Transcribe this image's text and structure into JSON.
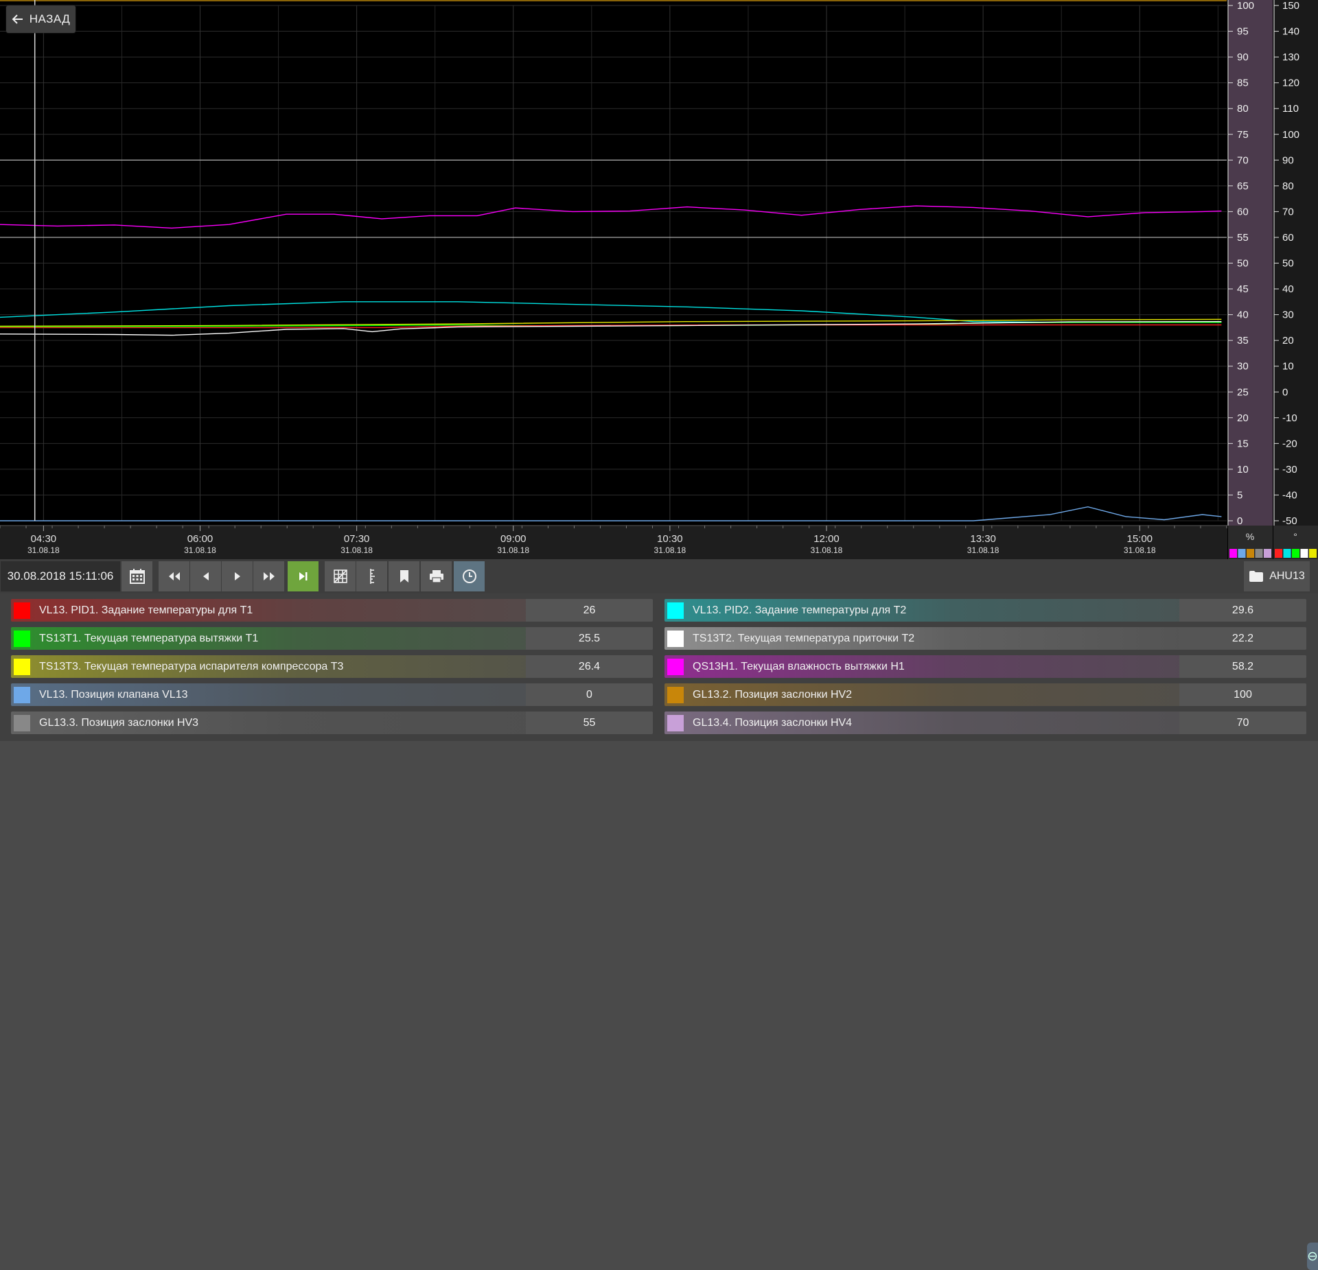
{
  "back_button": {
    "label": "НАЗАД",
    "icon": "arrow-left-icon"
  },
  "chart_data": {
    "type": "line",
    "x_ticks": [
      {
        "time": "04:30",
        "date": "31.08.18"
      },
      {
        "time": "06:00",
        "date": "31.08.18"
      },
      {
        "time": "07:30",
        "date": "31.08.18"
      },
      {
        "time": "09:00",
        "date": "31.08.18"
      },
      {
        "time": "10:30",
        "date": "31.08.18"
      },
      {
        "time": "12:00",
        "date": "31.08.18"
      },
      {
        "time": "13:30",
        "date": "31.08.18"
      },
      {
        "time": "15:00",
        "date": "31.08.18"
      }
    ],
    "xlim": [
      "04:05",
      "15:50"
    ],
    "y_axis_percent": {
      "unit": "%",
      "min": 0,
      "max": 100,
      "step": 5,
      "highlight_color": "#4b3a4c"
    },
    "y_axis_degrees": {
      "unit": "°",
      "min": -50,
      "max": 150,
      "step": 10
    },
    "grid": true,
    "cursor_time": "04:25",
    "reference_lines_percent": [
      70,
      55
    ],
    "series": [
      {
        "color": "#ff00ff",
        "axis": "percent",
        "points": [
          [
            0,
            57.5
          ],
          [
            30,
            57.2
          ],
          [
            60,
            57.4
          ],
          [
            90,
            56.8
          ],
          [
            120,
            57.5
          ],
          [
            150,
            59.5
          ],
          [
            175,
            59.5
          ],
          [
            200,
            58.6
          ],
          [
            225,
            59.2
          ],
          [
            250,
            59.2
          ],
          [
            270,
            60.7
          ],
          [
            300,
            60.0
          ],
          [
            330,
            60.1
          ],
          [
            360,
            60.9
          ],
          [
            390,
            60.3
          ],
          [
            420,
            59.3
          ],
          [
            450,
            60.4
          ],
          [
            480,
            61.1
          ],
          [
            510,
            60.8
          ],
          [
            540,
            60.1
          ],
          [
            570,
            59.0
          ],
          [
            600,
            59.8
          ],
          [
            630,
            60.0
          ],
          [
            640,
            60.1
          ]
        ]
      },
      {
        "color": "#00e5e5",
        "axis": "degrees",
        "points": [
          [
            0,
            29
          ],
          [
            60,
            31
          ],
          [
            120,
            33.5
          ],
          [
            180,
            35
          ],
          [
            240,
            35
          ],
          [
            300,
            34
          ],
          [
            360,
            33
          ],
          [
            420,
            31.5
          ],
          [
            480,
            29
          ],
          [
            510,
            27.3
          ],
          [
            560,
            27
          ],
          [
            640,
            27.2
          ]
        ]
      },
      {
        "color": "#e8e800",
        "axis": "degrees",
        "points": [
          [
            0,
            25.5
          ],
          [
            120,
            25.8
          ],
          [
            240,
            26.4
          ],
          [
            360,
            27.3
          ],
          [
            480,
            27.6
          ],
          [
            560,
            28
          ],
          [
            640,
            28.2
          ]
        ]
      },
      {
        "color": "#00ff00",
        "axis": "degrees",
        "points": [
          [
            0,
            25.2
          ],
          [
            120,
            25.5
          ],
          [
            240,
            26
          ],
          [
            300,
            25.6
          ],
          [
            360,
            25.8
          ],
          [
            480,
            26.2
          ],
          [
            520,
            26.8
          ],
          [
            560,
            27.0
          ],
          [
            640,
            27.0
          ]
        ]
      },
      {
        "color": "#ff2020",
        "axis": "degrees",
        "points": [
          [
            0,
            25.0
          ],
          [
            200,
            25.0
          ],
          [
            240,
            25.5
          ],
          [
            300,
            25.8
          ],
          [
            380,
            26.0
          ],
          [
            480,
            26.0
          ],
          [
            640,
            26.0
          ]
        ]
      },
      {
        "color": "#ffffff",
        "axis": "degrees",
        "points": [
          [
            0,
            22.5
          ],
          [
            60,
            22.3
          ],
          [
            90,
            22.0
          ],
          [
            120,
            22.8
          ],
          [
            150,
            24.3
          ],
          [
            180,
            24.6
          ],
          [
            195,
            23.4
          ],
          [
            210,
            24.5
          ],
          [
            240,
            25.2
          ],
          [
            300,
            25.5
          ],
          [
            360,
            25.8
          ],
          [
            480,
            26.4
          ],
          [
            560,
            27.2
          ],
          [
            640,
            27.3
          ]
        ]
      },
      {
        "color": "#6ea8e8",
        "axis": "percent",
        "points": [
          [
            0,
            0
          ],
          [
            510,
            0
          ],
          [
            530,
            0.6
          ],
          [
            550,
            1.2
          ],
          [
            570,
            2.7
          ],
          [
            590,
            0.8
          ],
          [
            610,
            0.2
          ],
          [
            630,
            1.2
          ],
          [
            640,
            0.8
          ]
        ]
      }
    ]
  },
  "axis_units": {
    "percent": "%",
    "degrees": "°"
  },
  "axis_color_swatches": {
    "percent": [
      "#ff00ff",
      "#6ea8e8",
      "#c8860a",
      "#888888",
      "#c8a0d8"
    ],
    "degrees": [
      "#ff2020",
      "#00e5e5",
      "#00ff00",
      "#ffffff",
      "#e8e800"
    ]
  },
  "toolbar": {
    "datetime": "30.08.2018  15:11:06",
    "buttons": [
      {
        "name": "calendar-icon"
      },
      {
        "name": "rewind-icon"
      },
      {
        "name": "step-back-icon"
      },
      {
        "name": "play-icon"
      },
      {
        "name": "fast-forward-icon"
      },
      {
        "name": "skip-to-end-icon"
      },
      {
        "name": "grid-toggle-icon"
      },
      {
        "name": "ruler-icon"
      },
      {
        "name": "bookmark-icon"
      },
      {
        "name": "print-icon"
      },
      {
        "name": "clock-icon"
      }
    ],
    "folder_label": "AHU13"
  },
  "legend": [
    {
      "label": "VL13. PID1. Задание температуры для T1",
      "value": "26",
      "color": "#ff0000"
    },
    {
      "label": "VL13. PID2. Задание температуры для T2",
      "value": "29.6",
      "color": "#00ffff"
    },
    {
      "label": "TS13T1. Текущая температура вытяжки T1",
      "value": "25.5",
      "color": "#00ff00"
    },
    {
      "label": "TS13T2. Текущая температура приточки T2",
      "value": "22.2",
      "color": "#ffffff"
    },
    {
      "label": "TS13T3. Текущая температура испарителя компрессора T3",
      "value": "26.4",
      "color": "#ffff00"
    },
    {
      "label": "QS13H1. Текущая влажность вытяжки H1",
      "value": "58.2",
      "color": "#ff00ff"
    },
    {
      "label": "VL13. Позиция клапана VL13",
      "value": "0",
      "color": "#6ea8e8"
    },
    {
      "label": "GL13.2. Позиция заслонки HV2",
      "value": "100",
      "color": "#c8860a"
    },
    {
      "label": "GL13.3. Позиция заслонки HV3",
      "value": "55",
      "color": "#888888"
    },
    {
      "label": "GL13.4. Позиция заслонки HV4",
      "value": "70",
      "color": "#c8a0d8"
    }
  ]
}
